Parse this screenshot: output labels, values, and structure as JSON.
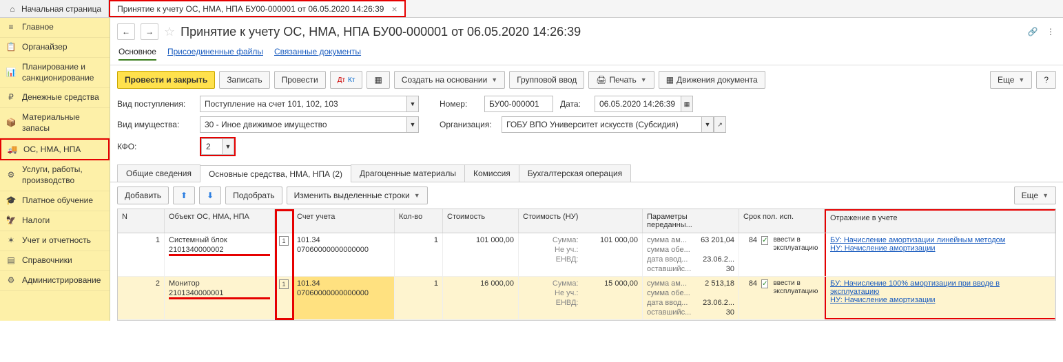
{
  "tabs": {
    "home": "Начальная страница",
    "doc": "Принятие к учету ОС, НМА, НПА БУ00-000001 от 06.05.2020 14:26:39"
  },
  "sidebar": [
    "Главное",
    "Органайзер",
    "Планирование и санкционирование",
    "Денежные средства",
    "Материальные запасы",
    "ОС, НМА, НПА",
    "Услуги, работы, производство",
    "Платное обучение",
    "Налоги",
    "Учет и отчетность",
    "Справочники",
    "Администрирование"
  ],
  "title": "Принятие к учету ОС, НМА, НПА БУ00-000001 от 06.05.2020 14:26:39",
  "subtabs": {
    "main": "Основное",
    "files": "Присоединенные файлы",
    "linked": "Связанные документы"
  },
  "toolbar": {
    "post_close": "Провести и закрыть",
    "save": "Записать",
    "post": "Провести",
    "create": "Создать на основании",
    "group": "Групповой ввод",
    "print": "Печать",
    "moves": "Движения документа",
    "more": "Еще"
  },
  "form": {
    "vid_post_lbl": "Вид поступления:",
    "vid_post_val": "Поступление на счет 101, 102, 103",
    "nomer_lbl": "Номер:",
    "nomer_val": "БУ00-000001",
    "data_lbl": "Дата:",
    "data_val": "06.05.2020 14:26:39",
    "vid_im_lbl": "Вид имущества:",
    "vid_im_val": "30 - Иное движимое имущество",
    "org_lbl": "Организация:",
    "org_val": "ГОБУ ВПО Университет искусств (Субсидия)",
    "kfo_lbl": "КФО:",
    "kfo_val": "2"
  },
  "inner_tabs": [
    "Общие сведения",
    "Основные средства, НМА, НПА (2)",
    "Драгоценные материалы",
    "Комиссия",
    "Бухгалтерская операция"
  ],
  "inner_toolbar": {
    "add": "Добавить",
    "pick": "Подобрать",
    "edit": "Изменить выделенные строки",
    "more": "Еще"
  },
  "headers": {
    "n": "N",
    "obj": "Объект ОС, НМА, НПА",
    "acc": "Счет учета",
    "qty": "Кол-во",
    "cost": "Стоимость",
    "cost_nu": "Стоимость (НУ)",
    "params": "Параметры переданны...",
    "srok": "Срок пол. исп.",
    "refl": "Отражение в учете"
  },
  "nu_labels": [
    "Сумма:",
    "Не уч.:",
    "ЕНВД:"
  ],
  "param_labels": [
    "сумма ам...",
    "сумма обе...",
    "дата ввод...",
    "оставшийс..."
  ],
  "vv": "ввести в эксплуатацию",
  "rows": [
    {
      "n": "1",
      "obj": "Системный блок",
      "inv": "2101340000002",
      "acc": "101.34",
      "ext": "07060000000000000",
      "qty": "1",
      "cost": "101 000,00",
      "nu_sum": "101 000,00",
      "p_sum": "63 201,04",
      "p_date": "23.06.2...",
      "p_rem": "30",
      "srok": "84",
      "refl1": "БУ: Начисление амортизации линейным методом",
      "refl2": "НУ: Начисление амортизации"
    },
    {
      "n": "2",
      "obj": "Монитор",
      "inv": "2101340000001",
      "acc": "101.34",
      "ext": "07060000000000000",
      "qty": "1",
      "cost": "16 000,00",
      "nu_sum": "15 000,00",
      "p_sum": "2 513,18",
      "p_date": "23.06.2...",
      "p_rem": "30",
      "srok": "84",
      "refl1": "БУ: Начисление 100% амортизации при вводе в эксплуатацию",
      "refl2": "НУ: Начисление амортизации"
    }
  ]
}
